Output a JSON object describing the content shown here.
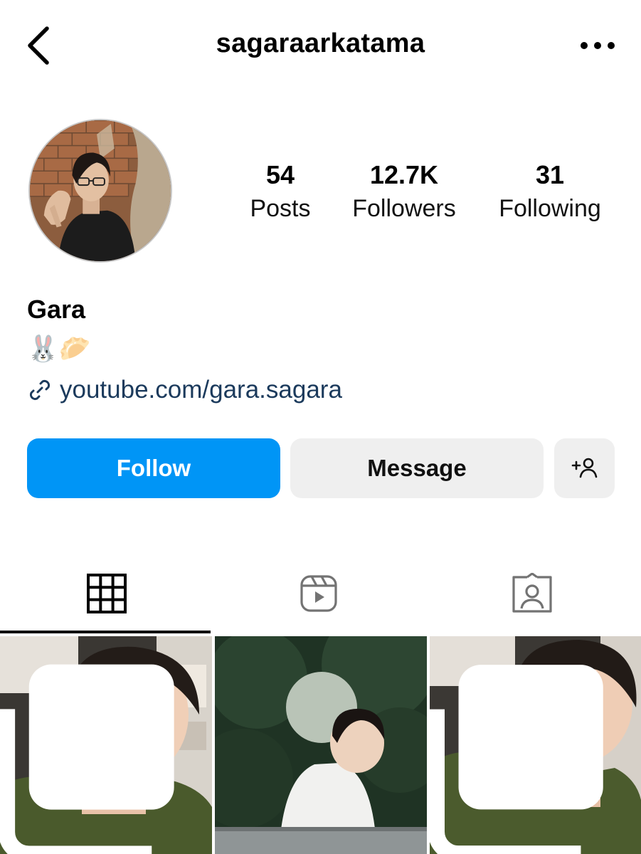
{
  "header": {
    "username": "sagaraarkatama",
    "back_icon": "chevron-left-icon",
    "more_icon": "more-horizontal-icon"
  },
  "profile": {
    "avatar_alt": "profile photo",
    "stats": [
      {
        "value": "54",
        "label": "Posts"
      },
      {
        "value": "12.7K",
        "label": "Followers"
      },
      {
        "value": "31",
        "label": "Following"
      }
    ],
    "display_name": "Gara",
    "bio": "🐰🥟",
    "link": "youtube.com/gara.sagara"
  },
  "actions": {
    "follow_label": "Follow",
    "message_label": "Message",
    "suggest_icon": "add-person-icon"
  },
  "tabs": [
    {
      "name": "grid",
      "icon": "grid-icon",
      "active": true
    },
    {
      "name": "reels",
      "icon": "reels-icon",
      "active": false
    },
    {
      "name": "tagged",
      "icon": "tagged-icon",
      "active": false
    }
  ],
  "posts": [
    {
      "multiple": true
    },
    {
      "multiple": false
    },
    {
      "multiple": true
    }
  ],
  "colors": {
    "accent": "#0095f6",
    "link": "#1b3a5c",
    "button_gray": "#efefef"
  }
}
